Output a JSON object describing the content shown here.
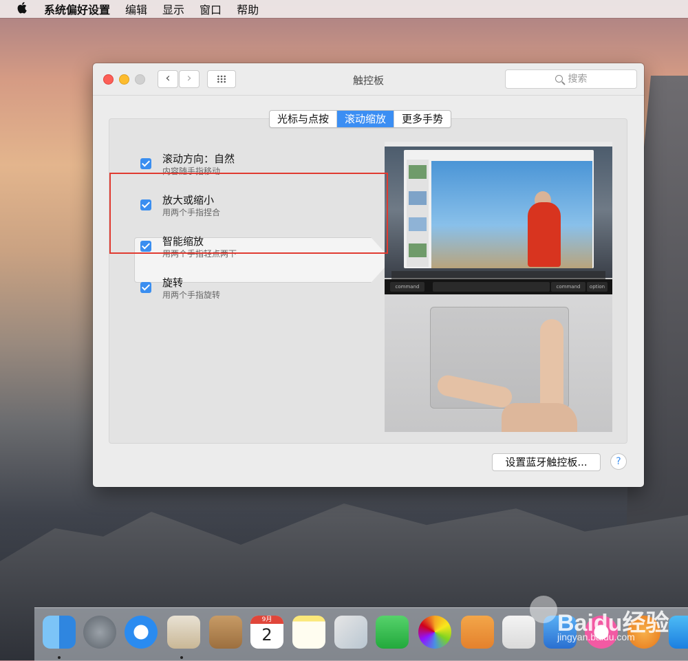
{
  "menubar": {
    "apple_icon": "apple-logo-icon",
    "items": [
      "系统偏好设置",
      "编辑",
      "显示",
      "窗口",
      "帮助"
    ]
  },
  "window": {
    "title": "触控板",
    "search_placeholder": "搜索",
    "tabs": [
      {
        "label": "光标与点按",
        "active": false
      },
      {
        "label": "滚动缩放",
        "active": true
      },
      {
        "label": "更多手势",
        "active": false
      }
    ],
    "options": [
      {
        "title": "滚动方向：自然",
        "subtitle": "内容随手指移动",
        "checked": true
      },
      {
        "title": "放大或缩小",
        "subtitle": "用两个手指捏合",
        "checked": true
      },
      {
        "title": "智能缩放",
        "subtitle": "用两个手指轻点两下",
        "checked": true
      },
      {
        "title": "旋转",
        "subtitle": "用两个手指旋转",
        "checked": true
      }
    ],
    "preview_keys": [
      "command",
      "command",
      "option"
    ],
    "bluetooth_button": "设置蓝牙触控板...",
    "help_label": "?"
  },
  "calendar_icon": {
    "month": "9月",
    "day": "2"
  },
  "watermark": {
    "brand": "Baidu经验",
    "url": "jingyan.baidu.com"
  },
  "colors": {
    "accent": "#3b8ef3",
    "highlight_box": "#e03a30"
  }
}
